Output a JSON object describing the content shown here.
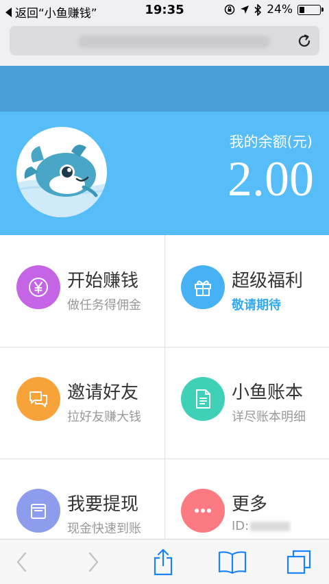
{
  "status_bar": {
    "back_label": "返回“小鱼赚钱”",
    "time": "19:35",
    "battery": "24%",
    "battery_level": 0.24
  },
  "browser": {
    "reload_icon": "reload-icon"
  },
  "header": {
    "balance_label": "我的余额(元)",
    "balance_value": "2.00"
  },
  "menu": [
    {
      "title": "开始赚钱",
      "subtitle": "做任务得佣金",
      "icon": "yen-icon",
      "color": "#c565e6"
    },
    {
      "title": "超级福利",
      "subtitle": "敬请期待",
      "icon": "gift-icon",
      "color": "#46b2f5"
    },
    {
      "title": "邀请好友",
      "subtitle": "拉好友赚大钱",
      "icon": "chat-icon",
      "color": "#f8a23a"
    },
    {
      "title": "小鱼账本",
      "subtitle": "详尽账本明细",
      "icon": "document-icon",
      "color": "#3fd1b7"
    },
    {
      "title": "我要提现",
      "subtitle": "现金快速到账",
      "icon": "wallet-icon",
      "color": "#8d9cec"
    },
    {
      "title": "更多",
      "subtitle": "ID:",
      "icon": "more-icon",
      "color": "#fc7b82"
    }
  ],
  "toolbar": {
    "accent": "#1a82fb",
    "disabled": "#c4c4c8"
  }
}
